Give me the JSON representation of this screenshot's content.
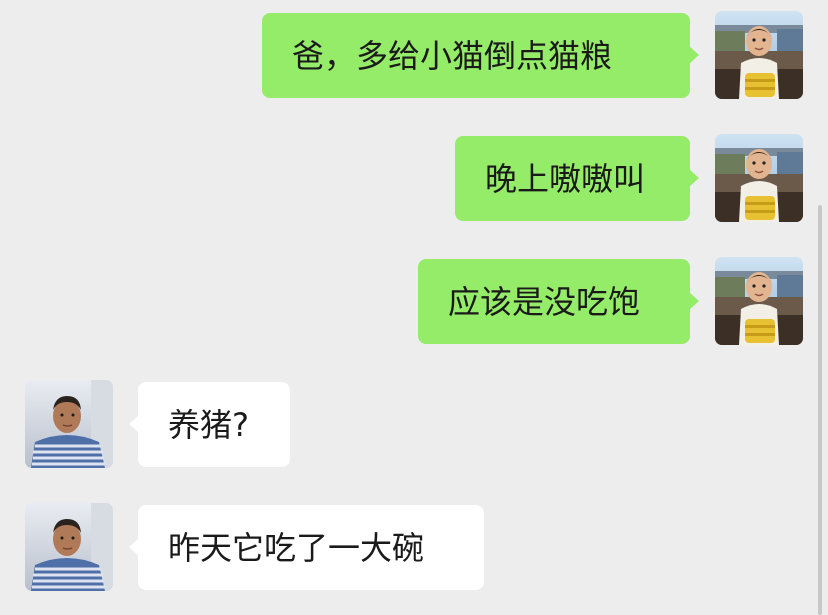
{
  "colors": {
    "background": "#ededed",
    "self_bubble": "#95ec69",
    "other_bubble": "#ffffff",
    "text": "#1a1a1a"
  },
  "messages": [
    {
      "sender": "self",
      "text": "爸，多给小猫倒点猫粮",
      "avatar": "child-avatar"
    },
    {
      "sender": "self",
      "text": "晚上嗷嗷叫",
      "avatar": "child-avatar"
    },
    {
      "sender": "self",
      "text": "应该是没吃饱",
      "avatar": "child-avatar"
    },
    {
      "sender": "other",
      "text": "养猪?",
      "avatar": "father-avatar"
    },
    {
      "sender": "other",
      "text": "昨天它吃了一大碗",
      "avatar": "father-avatar"
    }
  ]
}
